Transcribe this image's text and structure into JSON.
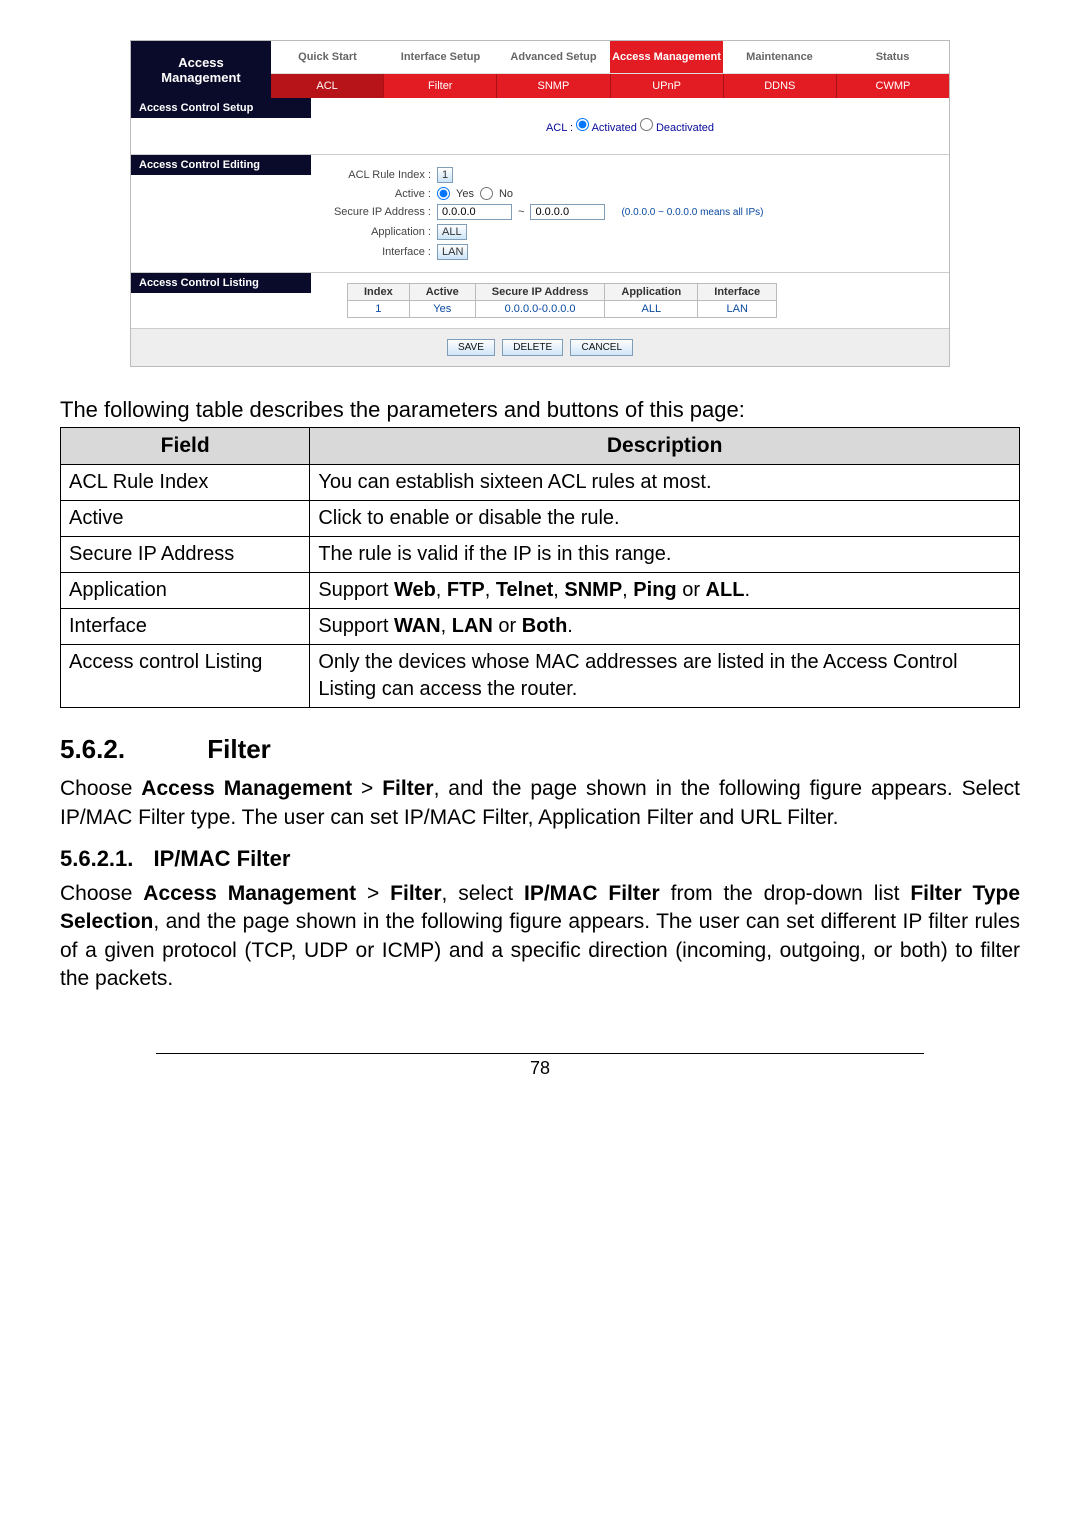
{
  "screenshot": {
    "sidebar_title_1": "Access",
    "sidebar_title_2": "Management",
    "top_tabs": [
      "Quick Start",
      "Interface Setup",
      "Advanced Setup",
      "Access Management",
      "Maintenance",
      "Status"
    ],
    "top_tabs_active_index": 3,
    "sub_tabs": [
      "ACL",
      "Filter",
      "SNMP",
      "UPnP",
      "DDNS",
      "CWMP"
    ],
    "sub_tabs_active_index": 0,
    "group1_title": "Access Control Setup",
    "acl_label": "ACL :",
    "acl_opt1": "Activated",
    "acl_opt2": "Deactivated",
    "group2_title": "Access Control Editing",
    "rule_index_label": "ACL Rule Index :",
    "rule_index_value": "1",
    "active_label": "Active :",
    "active_opt1": "Yes",
    "active_opt2": "No",
    "secure_ip_label": "Secure IP Address :",
    "secure_ip_from": "0.0.0.0",
    "secure_ip_to": "0.0.0.0",
    "secure_ip_note": "(0.0.0.0 ~ 0.0.0.0 means all IPs)",
    "application_label": "Application :",
    "application_value": "ALL",
    "interface_label": "Interface :",
    "interface_value": "LAN",
    "group3_title": "Access Control Listing",
    "listing_headers": [
      "Index",
      "Active",
      "Secure IP Address",
      "Application",
      "Interface"
    ],
    "listing_row": [
      "1",
      "Yes",
      "0.0.0.0-0.0.0.0",
      "ALL",
      "LAN"
    ],
    "btn_save": "SAVE",
    "btn_delete": "DELETE",
    "btn_cancel": "CANCEL"
  },
  "table_caption": "The following table describes the parameters and buttons of this page:",
  "param_table": {
    "headers": [
      "Field",
      "Description"
    ],
    "rows": [
      [
        "ACL Rule Index",
        "You can establish sixteen ACL rules at most."
      ],
      [
        "Active",
        "Click to enable or disable the rule."
      ],
      [
        "Secure IP Address",
        "The rule is valid if the IP is in this range."
      ],
      [
        "Application",
        "Support <b>Web</b>, <b>FTP</b>, <b>Telnet</b>, <b>SNMP</b>, <b>Ping</b> or <b>ALL</b>."
      ],
      [
        "Interface",
        "Support <b>WAN</b>, <b>LAN</b> or <b>Both</b>."
      ],
      [
        "Access control Listing",
        "Only the devices whose MAC addresses are listed in the Access Control Listing can access the router."
      ]
    ]
  },
  "heading_562_num": "5.6.2.",
  "heading_562_title": "Filter",
  "para_562": "Choose <b>Access Management</b> > <b>Filter</b>, and the page shown in the following figure appears. Select IP/MAC Filter type. The user can set IP/MAC Filter, Application Filter and URL Filter.",
  "heading_5621_num": "5.6.2.1.",
  "heading_5621_title": "IP/MAC Filter",
  "para_5621": "Choose <b>Access Management</b> > <b>Filter</b>, select <b>IP/MAC Filter</b> from the drop-down list <b>Filter Type Selection</b>, and the page shown in the following figure appears. The user can set different IP filter rules of a given protocol (TCP, UDP or ICMP) and a specific direction (incoming, outgoing, or both) to filter the packets.",
  "page_number": "78"
}
